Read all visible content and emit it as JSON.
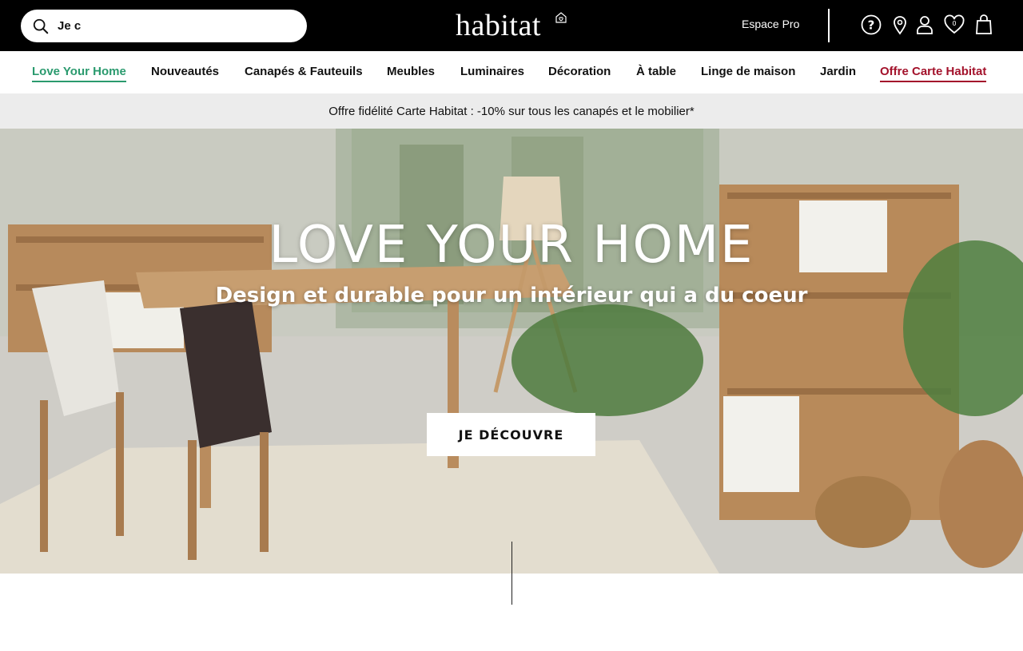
{
  "header": {
    "search": {
      "value": "Je c",
      "placeholder": ""
    },
    "logo_text": "habitat",
    "espace_pro": "Espace Pro",
    "icons": [
      "help-icon",
      "store-locator-icon",
      "account-icon",
      "wishlist-icon",
      "cart-icon"
    ]
  },
  "nav": {
    "items": [
      {
        "label": "Love Your Home"
      },
      {
        "label": "Nouveautés"
      },
      {
        "label": "Canapés & Fauteuils"
      },
      {
        "label": "Meubles"
      },
      {
        "label": "Luminaires"
      },
      {
        "label": "Décoration"
      },
      {
        "label": "À table"
      },
      {
        "label": "Linge de maison"
      },
      {
        "label": "Jardin"
      },
      {
        "label": "Offre Carte Habitat"
      }
    ]
  },
  "promo": {
    "text": "Offre fidélité Carte Habitat : -10% sur tous les canapés et le mobilier*"
  },
  "hero": {
    "title": "LOVE YOUR HOME",
    "subtitle": "Design et durable pour un intérieur qui a du coeur",
    "cta": "JE DÉCOUVRE"
  },
  "colors": {
    "header_bg": "#000000",
    "active_nav": "#2a9a6e",
    "offer_nav": "#a3122b",
    "promo_bg": "#ececec"
  }
}
